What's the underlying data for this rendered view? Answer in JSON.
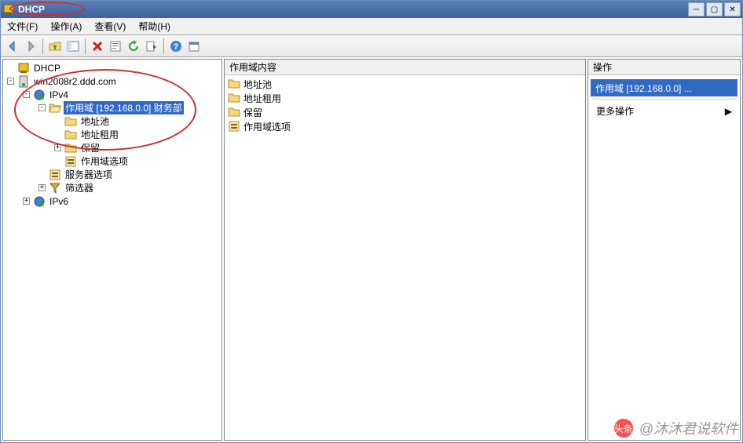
{
  "window": {
    "title": "DHCP"
  },
  "menu": {
    "file": "文件(F)",
    "action": "操作(A)",
    "view": "查看(V)",
    "help": "帮助(H)"
  },
  "tree": {
    "root": "DHCP",
    "server": "win2008r2.ddd.com",
    "ipv4": "IPv4",
    "scope": "作用域 [192.168.0.0] 财务部",
    "pool": "地址池",
    "leases": "地址租用",
    "reservations": "保留",
    "scope_options": "作用域选项",
    "server_options": "服务器选项",
    "filters": "筛选器",
    "ipv6": "IPv6"
  },
  "list": {
    "header": "作用域内容",
    "items": {
      "pool": "地址池",
      "leases": "地址租用",
      "reservations": "保留",
      "scope_options": "作用域选项"
    }
  },
  "actions": {
    "header": "操作",
    "title": "作用域 [192.168.0.0] ...",
    "more": "更多操作"
  },
  "watermark": {
    "text": "@沐沐君说软件"
  }
}
